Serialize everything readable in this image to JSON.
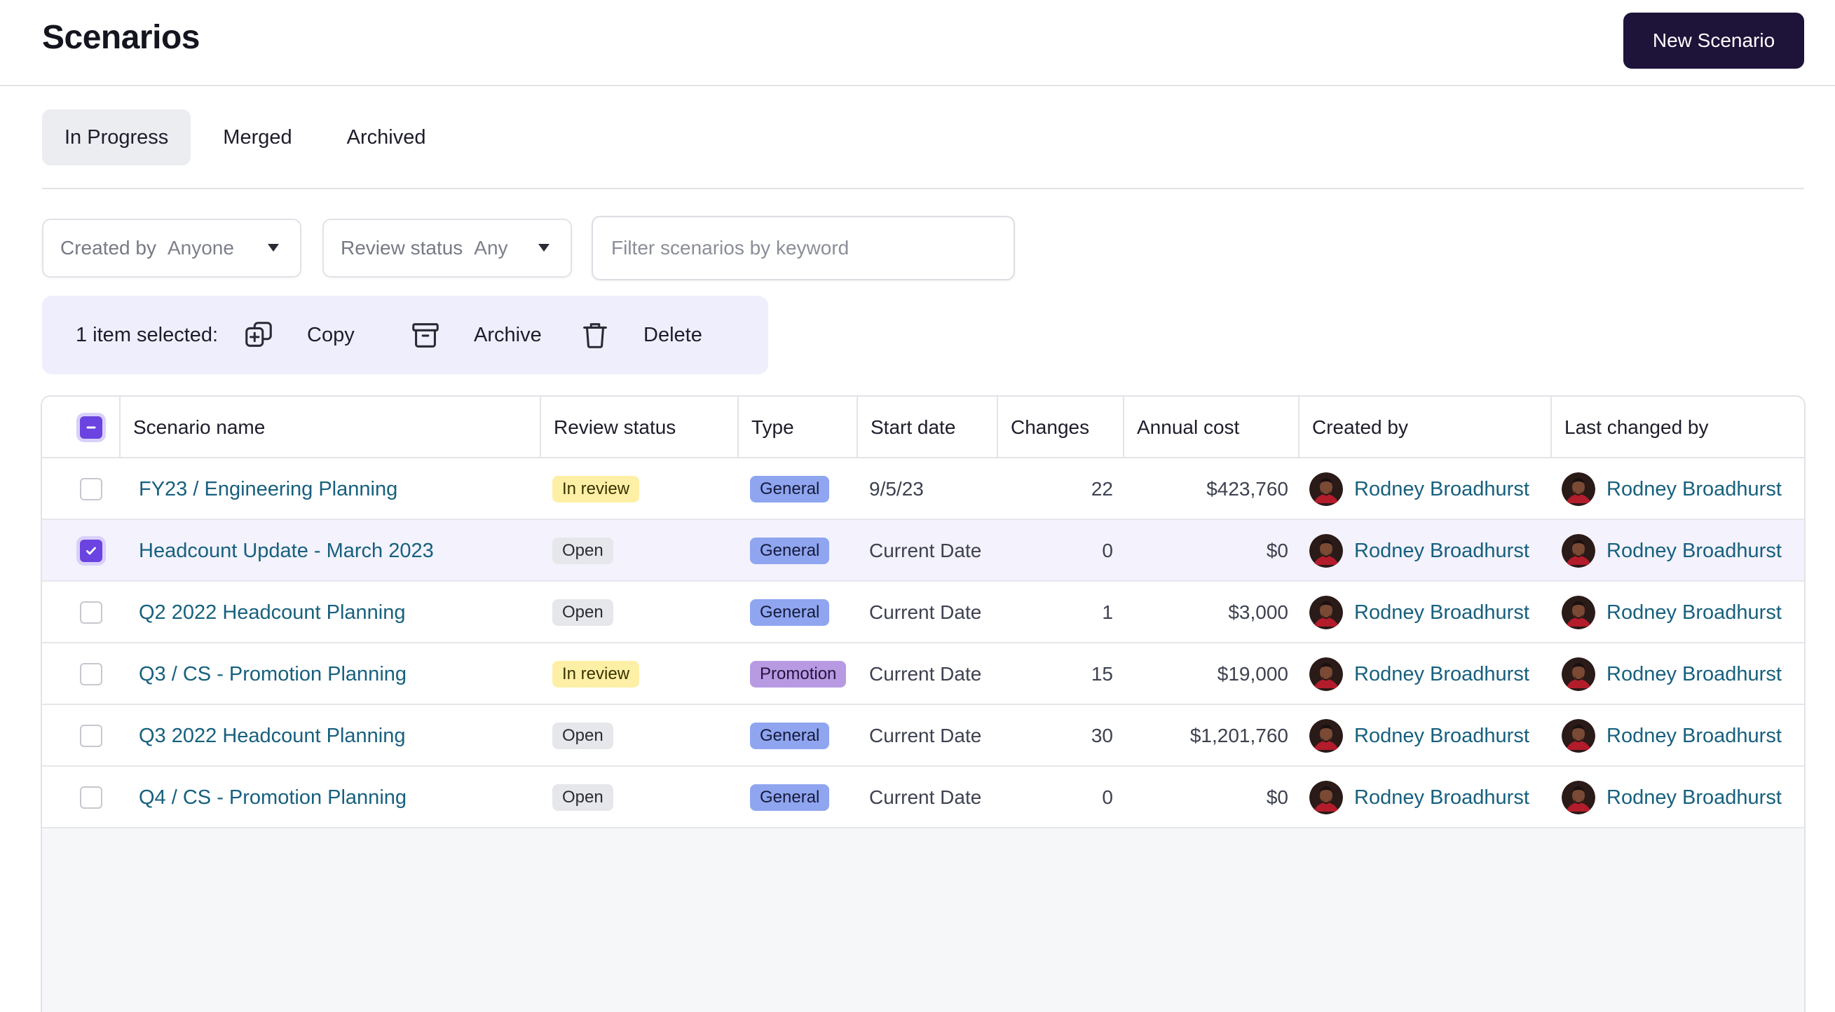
{
  "header": {
    "title": "Scenarios",
    "new_button": "New Scenario"
  },
  "tabs": [
    {
      "label": "In Progress",
      "active": true
    },
    {
      "label": "Merged",
      "active": false
    },
    {
      "label": "Archived",
      "active": false
    }
  ],
  "filters": {
    "created_by": {
      "label": "Created by",
      "value": "Anyone"
    },
    "review_status": {
      "label": "Review status",
      "value": "Any"
    },
    "search": {
      "placeholder": "Filter scenarios by keyword",
      "value": ""
    }
  },
  "selection": {
    "text": "1 item selected:",
    "copy_label": "Copy",
    "archive_label": "Archive",
    "delete_label": "Delete"
  },
  "table": {
    "columns": {
      "name": "Scenario name",
      "status": "Review status",
      "type": "Type",
      "start": "Start date",
      "changes": "Changes",
      "cost": "Annual cost",
      "created": "Created by",
      "changed": "Last changed by"
    },
    "rows": [
      {
        "name": "FY23 / Engineering Planning",
        "status": "In review",
        "type": "General",
        "start": "9/5/23",
        "changes": "22",
        "cost": "$423,760",
        "created_by": "Rodney Broadhurst",
        "changed_by": "Rodney Broadhurst",
        "selected": false
      },
      {
        "name": "Headcount Update - March 2023",
        "status": "Open",
        "type": "General",
        "start": "Current Date",
        "changes": "0",
        "cost": "$0",
        "created_by": "Rodney Broadhurst",
        "changed_by": "Rodney Broadhurst",
        "selected": true
      },
      {
        "name": "Q2 2022 Headcount Planning",
        "status": "Open",
        "type": "General",
        "start": "Current Date",
        "changes": "1",
        "cost": "$3,000",
        "created_by": "Rodney Broadhurst",
        "changed_by": "Rodney Broadhurst",
        "selected": false
      },
      {
        "name": "Q3 / CS - Promotion Planning",
        "status": "In review",
        "type": "Promotion",
        "start": "Current Date",
        "changes": "15",
        "cost": "$19,000",
        "created_by": "Rodney Broadhurst",
        "changed_by": "Rodney Broadhurst",
        "selected": false
      },
      {
        "name": "Q3 2022 Headcount Planning",
        "status": "Open",
        "type": "General",
        "start": "Current Date",
        "changes": "30",
        "cost": "$1,201,760",
        "created_by": "Rodney Broadhurst",
        "changed_by": "Rodney Broadhurst",
        "selected": false
      },
      {
        "name": "Q4 / CS - Promotion Planning",
        "status": "Open",
        "type": "General",
        "start": "Current Date",
        "changes": "0",
        "cost": "$0",
        "created_by": "Rodney Broadhurst",
        "changed_by": "Rodney Broadhurst",
        "selected": false
      }
    ]
  },
  "colors": {
    "primary": "#1e1339",
    "accent": "#6a43e0",
    "link": "#17607e",
    "badge_in_review": "#fdf0a6",
    "badge_open": "#e6e7eb",
    "badge_general": "#8fa5f0",
    "badge_promotion": "#b79ae2"
  }
}
